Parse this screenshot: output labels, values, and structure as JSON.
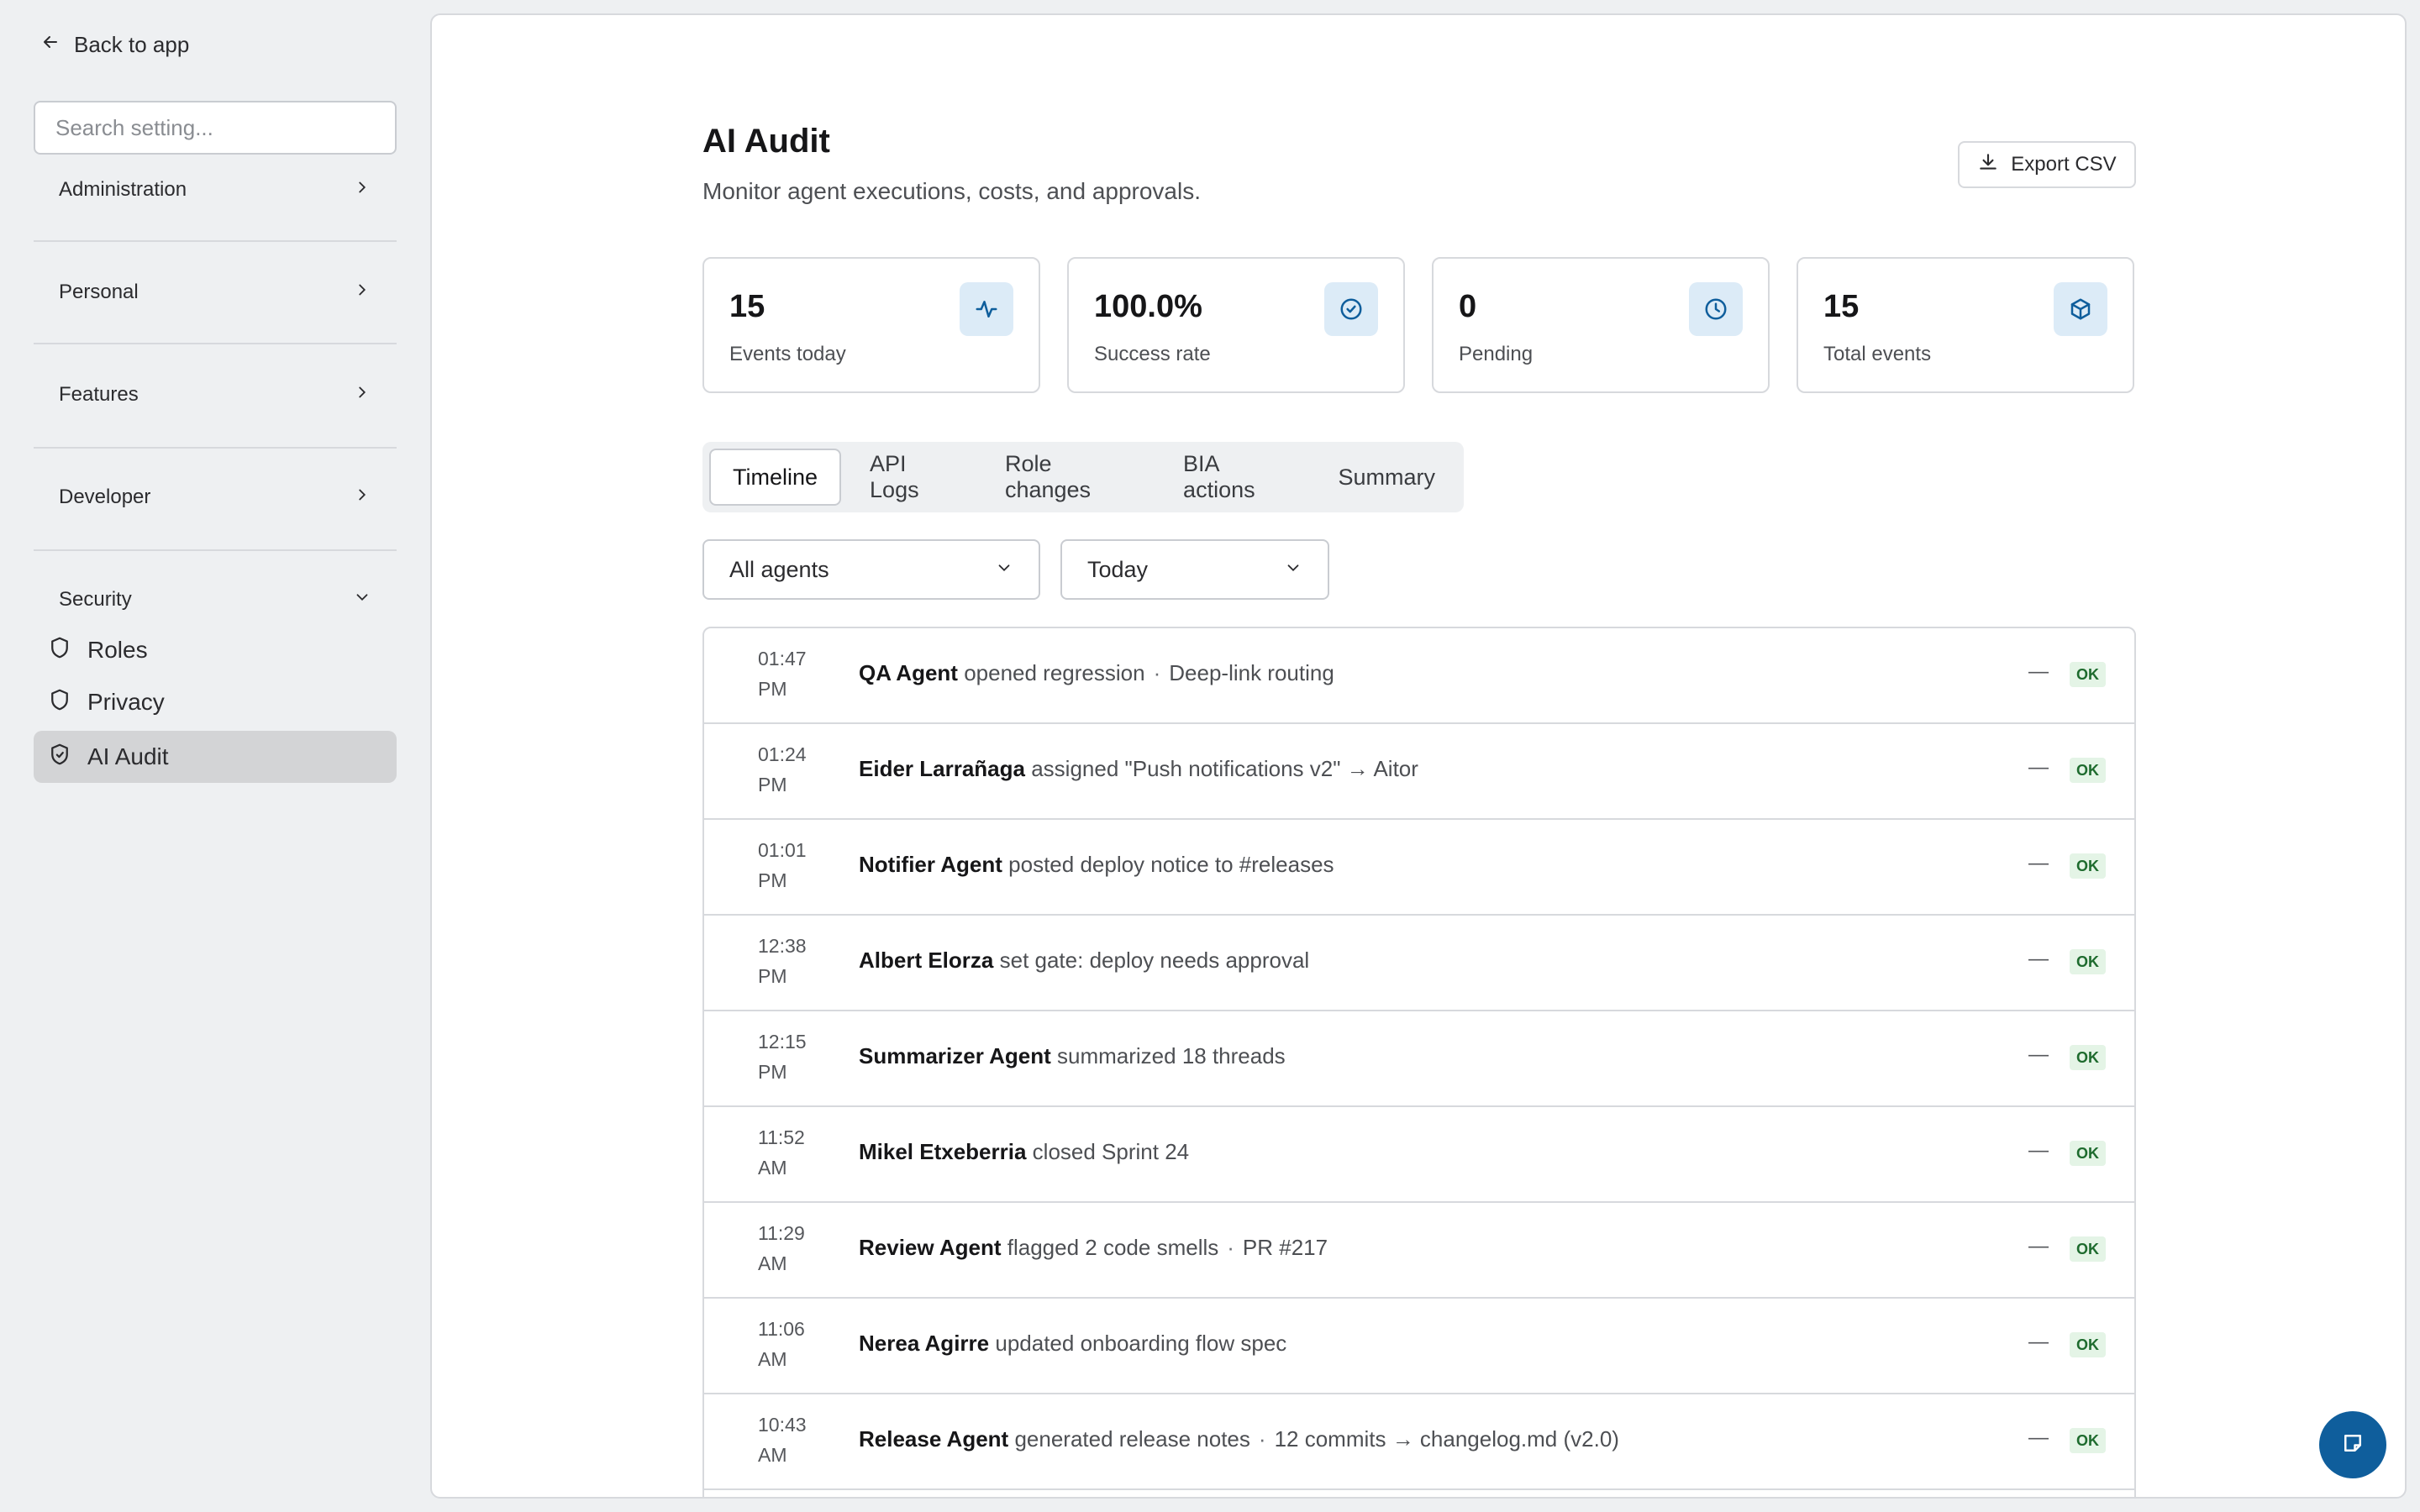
{
  "sidebar": {
    "back_label": "Back to app",
    "search_placeholder": "Search setting...",
    "sections": [
      {
        "label": "Administration",
        "expanded": false
      },
      {
        "label": "Personal",
        "expanded": false
      },
      {
        "label": "Features",
        "expanded": false
      },
      {
        "label": "Developer",
        "expanded": false
      },
      {
        "label": "Security",
        "expanded": true
      }
    ],
    "security_items": [
      {
        "label": "Roles",
        "icon": "shield-icon"
      },
      {
        "label": "Privacy",
        "icon": "shield-icon"
      },
      {
        "label": "AI Audit",
        "icon": "shield-check-icon",
        "active": true
      }
    ]
  },
  "header": {
    "title": "AI Audit",
    "subtitle": "Monitor agent executions, costs, and approvals.",
    "export_label": "Export CSV"
  },
  "stats": [
    {
      "value": "15",
      "label": "Events today",
      "icon": "activity-icon"
    },
    {
      "value": "100.0%",
      "label": "Success rate",
      "icon": "check-circle-icon"
    },
    {
      "value": "0",
      "label": "Pending",
      "icon": "clock-icon"
    },
    {
      "value": "15",
      "label": "Total events",
      "icon": "box-icon"
    }
  ],
  "tabs": [
    {
      "label": "Timeline",
      "active": true
    },
    {
      "label": "API Logs"
    },
    {
      "label": "Role changes"
    },
    {
      "label": "BIA actions"
    },
    {
      "label": "Summary"
    }
  ],
  "filters": {
    "agent": "All agents",
    "period": "Today"
  },
  "events": [
    {
      "time": "01:47",
      "ampm": "PM",
      "actor": "QA Agent",
      "action": "opened regression",
      "detail": "Deep-link routing",
      "cost": "—",
      "status": "OK"
    },
    {
      "time": "01:24",
      "ampm": "PM",
      "actor": "Eider Larrañaga",
      "action": "assigned \"Push notifications v2\" → Aitor",
      "detail": "",
      "cost": "—",
      "status": "OK"
    },
    {
      "time": "01:01",
      "ampm": "PM",
      "actor": "Notifier Agent",
      "action": "posted deploy notice to #releases",
      "detail": "",
      "cost": "—",
      "status": "OK"
    },
    {
      "time": "12:38",
      "ampm": "PM",
      "actor": "Albert Elorza",
      "action": "set gate: deploy needs approval",
      "detail": "",
      "cost": "—",
      "status": "OK"
    },
    {
      "time": "12:15",
      "ampm": "PM",
      "actor": "Summarizer Agent",
      "action": "summarized 18 threads",
      "detail": "",
      "cost": "—",
      "status": "OK"
    },
    {
      "time": "11:52",
      "ampm": "AM",
      "actor": "Mikel Etxeberria",
      "action": "closed Sprint 24",
      "detail": "",
      "cost": "—",
      "status": "OK"
    },
    {
      "time": "11:29",
      "ampm": "AM",
      "actor": "Review Agent",
      "action": "flagged 2 code smells",
      "detail": "PR #217",
      "cost": "—",
      "status": "OK"
    },
    {
      "time": "11:06",
      "ampm": "AM",
      "actor": "Nerea Agirre",
      "action": "updated onboarding flow spec",
      "detail": "",
      "cost": "—",
      "status": "OK"
    },
    {
      "time": "10:43",
      "ampm": "AM",
      "actor": "Release Agent",
      "action": "generated release notes",
      "detail": "12 commits → changelog.md (v2.0)",
      "cost": "—",
      "status": "OK"
    }
  ],
  "colors": {
    "accent": "#0f5e9c",
    "icon_bg": "#dcebf7",
    "ok_bg": "#e4f4e6",
    "ok_text": "#1e6b2e"
  }
}
